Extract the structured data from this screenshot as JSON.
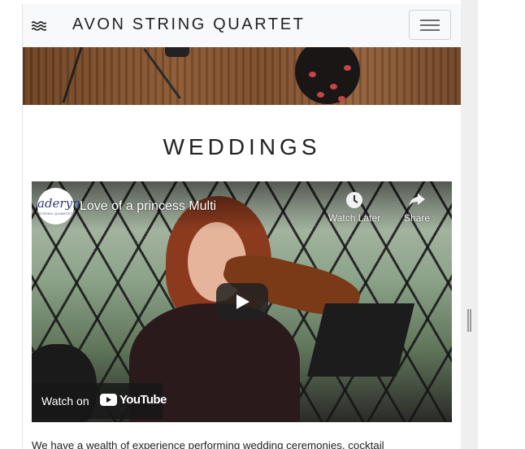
{
  "navbar": {
    "brand_icon": "waves-icon",
    "title": "AVON STRING QUARTET",
    "menu_icon": "hamburger-menu-icon"
  },
  "section": {
    "heading": "WEDDINGS"
  },
  "video": {
    "channel_logo_text": "aderyn",
    "channel_logo_subtext": "STRING QUARTET",
    "title": "Love of a princess Multi",
    "watch_later_label": "Watch Later",
    "share_label": "Share",
    "watch_on_label": "Watch on",
    "youtube_label": "YouTube"
  },
  "body": {
    "paragraph": "We have a wealth of experience performing wedding ceremonies, cocktail"
  },
  "colors": {
    "navbar_bg": "#f8f9fa",
    "text": "#222222",
    "youtube_red": "#ff0000"
  }
}
